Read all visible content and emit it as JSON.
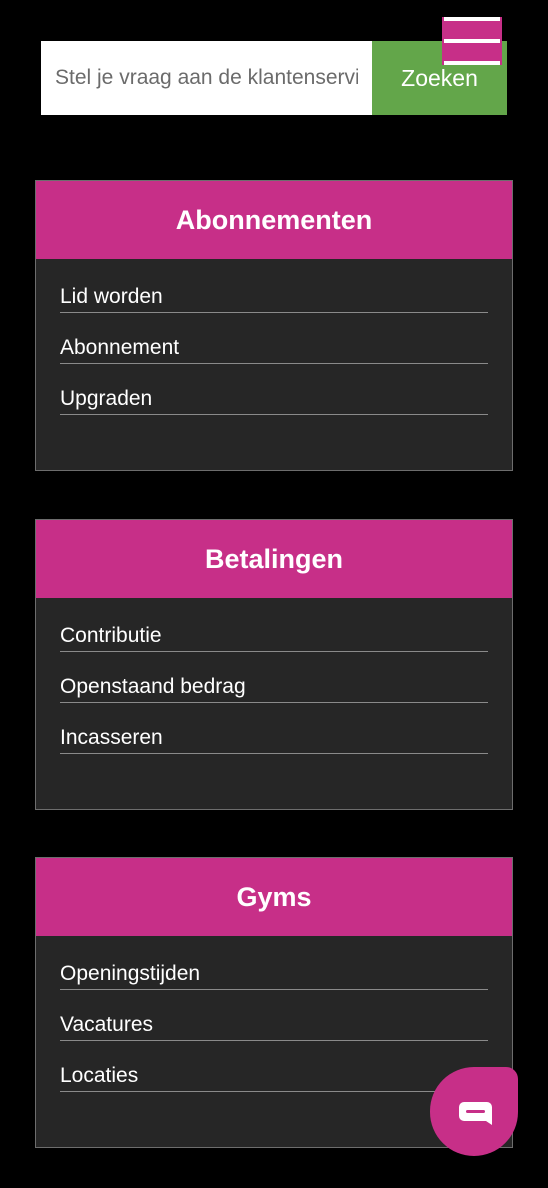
{
  "menu": {
    "icon": "hamburger-menu-icon",
    "accent_color": "#c72f88"
  },
  "search": {
    "placeholder": "Stel je vraag aan de klantenservice",
    "value": "",
    "button_label": "Zoeken",
    "button_color": "#63a64a"
  },
  "categories": [
    {
      "title": "Abonnementen",
      "links": [
        "Lid worden",
        "Abonnement",
        "Upgraden"
      ]
    },
    {
      "title": "Betalingen",
      "links": [
        "Contributie",
        "Openstaand bedrag",
        "Incasseren"
      ]
    },
    {
      "title": "Gyms",
      "links": [
        "Openingstijden",
        "Vacatures",
        "Locaties"
      ]
    }
  ],
  "chat": {
    "icon": "chat-bubble-icon",
    "color": "#c72f88"
  }
}
